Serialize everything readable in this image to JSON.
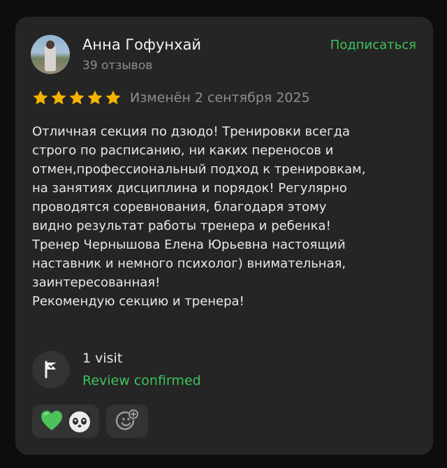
{
  "author": {
    "name": "Анна Гофунхай",
    "reviews_count": "39 отзывов"
  },
  "subscribe_label": "Подписаться",
  "rating": {
    "stars": 5,
    "max": 5,
    "edited": "Изменён 2 сентября 2025"
  },
  "review_text": "Отличная секция по дзюдо! Тренировки всегда\nстрого по расписанию, ни каких переносов и\nотмен,профессиональный подход к тренировкам,\nна занятиях дисциплина и порядок! Регулярно\nпроводятся соревнования, благодаря этому\nвидно результат работы тренера и ребенка!\nТренер Чернышова Елена Юрьевна настоящий\nнаставник и немного психолог) внимательная,\nзаинтересованная!\nРекомендую секцию и тренера!",
  "visit": {
    "count": "1 visit",
    "status": "Review confirmed"
  },
  "colors": {
    "accent_green": "#3ec35a",
    "star_gold": "#f4b400",
    "card_bg": "#252525"
  },
  "icons": {
    "visit": "flag-checkmark-icon",
    "reaction_1": "green-heart-emoji",
    "reaction_2": "panda-emoji",
    "add_reaction": "add-emoji-icon"
  }
}
